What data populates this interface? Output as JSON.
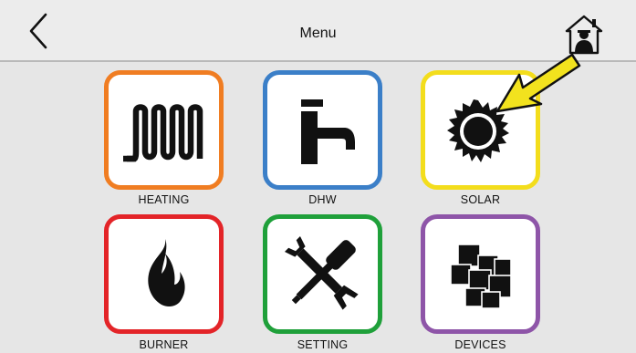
{
  "header": {
    "title": "Menu",
    "back_icon": "chevron-left-icon",
    "home_icon": "home-person-icon"
  },
  "tiles": [
    {
      "label": "HEATING",
      "icon": "radiator-coil-icon",
      "border_color": "#f07d22"
    },
    {
      "label": "DHW",
      "icon": "faucet-icon",
      "border_color": "#3b7fc8"
    },
    {
      "label": "SOLAR",
      "icon": "sun-icon",
      "border_color": "#f3dd1c"
    },
    {
      "label": "BURNER",
      "icon": "flame-icon",
      "border_color": "#e32428"
    },
    {
      "label": "SETTING",
      "icon": "wrench-screwdriver-icon",
      "border_color": "#1fa03a"
    },
    {
      "label": "DEVICES",
      "icon": "devices-blocks-icon",
      "border_color": "#8e55a8"
    }
  ],
  "annotation": {
    "icon": "pointer-arrow-icon",
    "color": "#f2e21e"
  }
}
